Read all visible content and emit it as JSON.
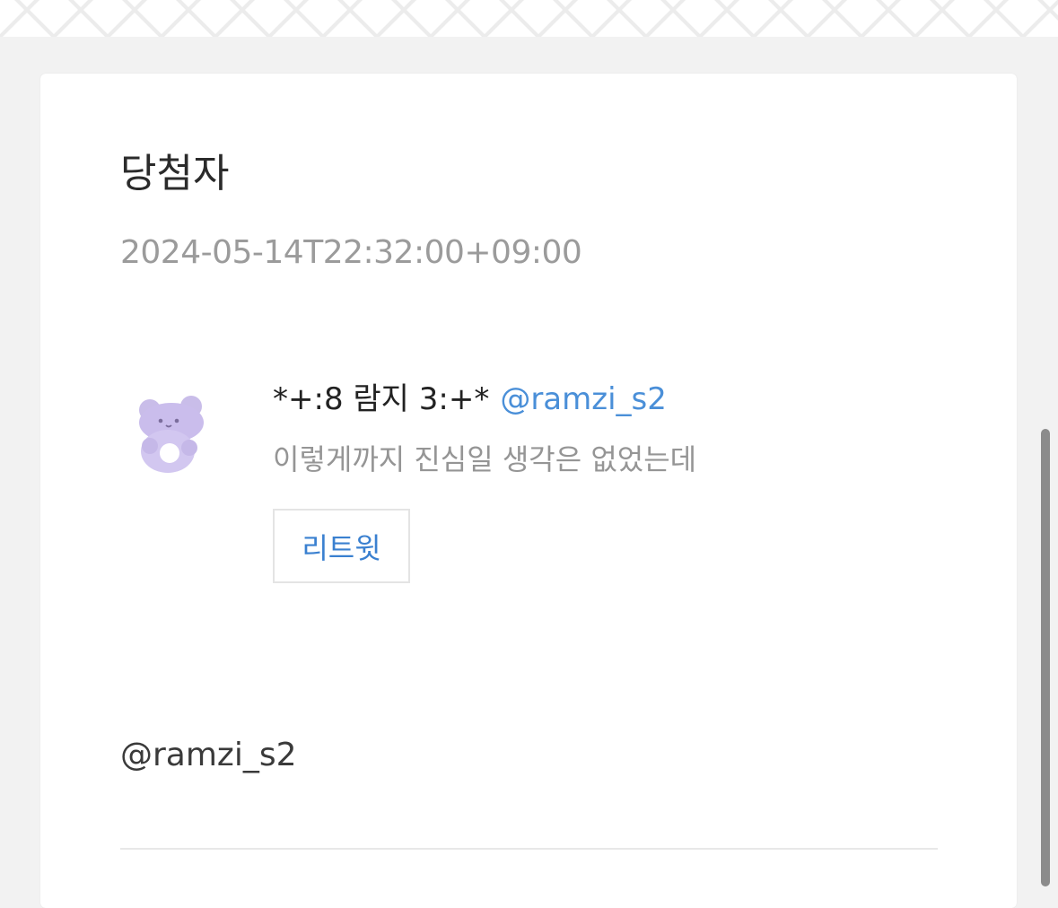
{
  "page": {
    "background_color": "#f2f2f2",
    "card_color": "#ffffff"
  },
  "post": {
    "title": "당첨자",
    "timestamp": "2024-05-14T22:32:00+09:00"
  },
  "tweet": {
    "avatar_icon": "lavender-hamster-avatar",
    "display_name": "*+:8 람지 3:+*",
    "handle": "@ramzi_s2",
    "text": "이렇게까지 진심일 생각은 없었는데",
    "retweet_label": "리트윗",
    "handle_color": "#4a8fd8"
  },
  "winner": {
    "handle": "@ramzi_s2"
  }
}
